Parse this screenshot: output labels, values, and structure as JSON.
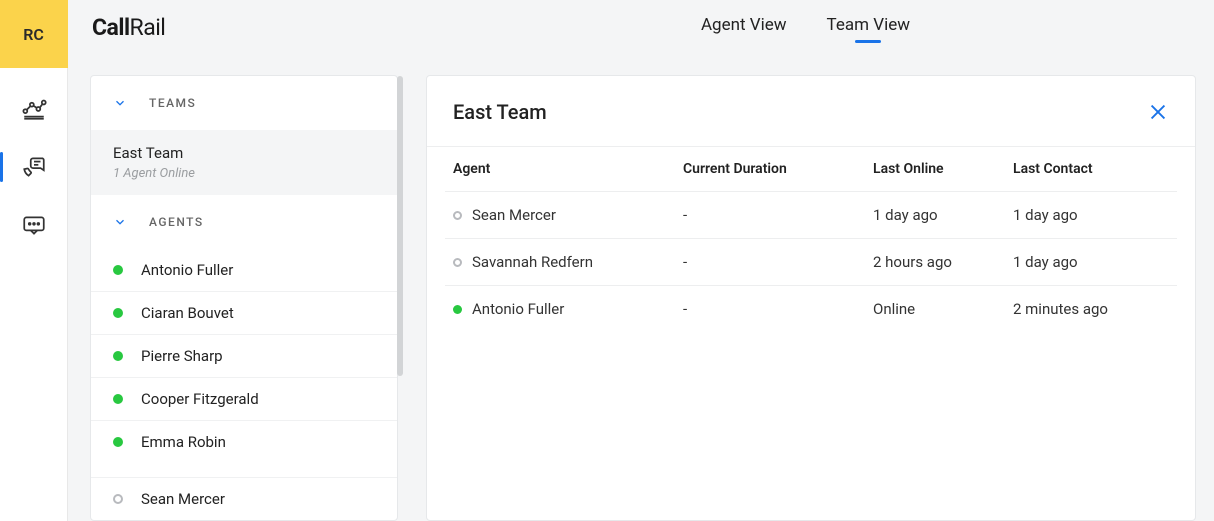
{
  "avatar": "RC",
  "logo": {
    "bold": "Call",
    "light": "Rail"
  },
  "viewTabs": [
    {
      "label": "Agent View",
      "active": false
    },
    {
      "label": "Team View",
      "active": true
    }
  ],
  "sidebar": {
    "teamsLabel": "TEAMS",
    "agentsLabel": "AGENTS",
    "team": {
      "name": "East Team",
      "sub": "1 Agent Online"
    },
    "agents": [
      {
        "name": "Antonio Fuller",
        "status": "online"
      },
      {
        "name": "Ciaran Bouvet",
        "status": "online"
      },
      {
        "name": "Pierre Sharp",
        "status": "online"
      },
      {
        "name": "Cooper Fitzgerald",
        "status": "online"
      },
      {
        "name": "Emma Robin",
        "status": "online"
      },
      {
        "name": "Sean Mercer",
        "status": "offline"
      }
    ]
  },
  "panel": {
    "title": "East Team",
    "columns": [
      "Agent",
      "Current Duration",
      "Last Online",
      "Last Contact"
    ],
    "rows": [
      {
        "name": "Sean Mercer",
        "status": "offline",
        "duration": "-",
        "lastOnline": "1 day ago",
        "lastContact": "1 day ago"
      },
      {
        "name": "Savannah Redfern",
        "status": "offline",
        "duration": "-",
        "lastOnline": "2 hours ago",
        "lastContact": "1 day ago"
      },
      {
        "name": "Antonio Fuller",
        "status": "online",
        "duration": "-",
        "lastOnline": "Online",
        "lastContact": "2 minutes ago"
      }
    ]
  }
}
